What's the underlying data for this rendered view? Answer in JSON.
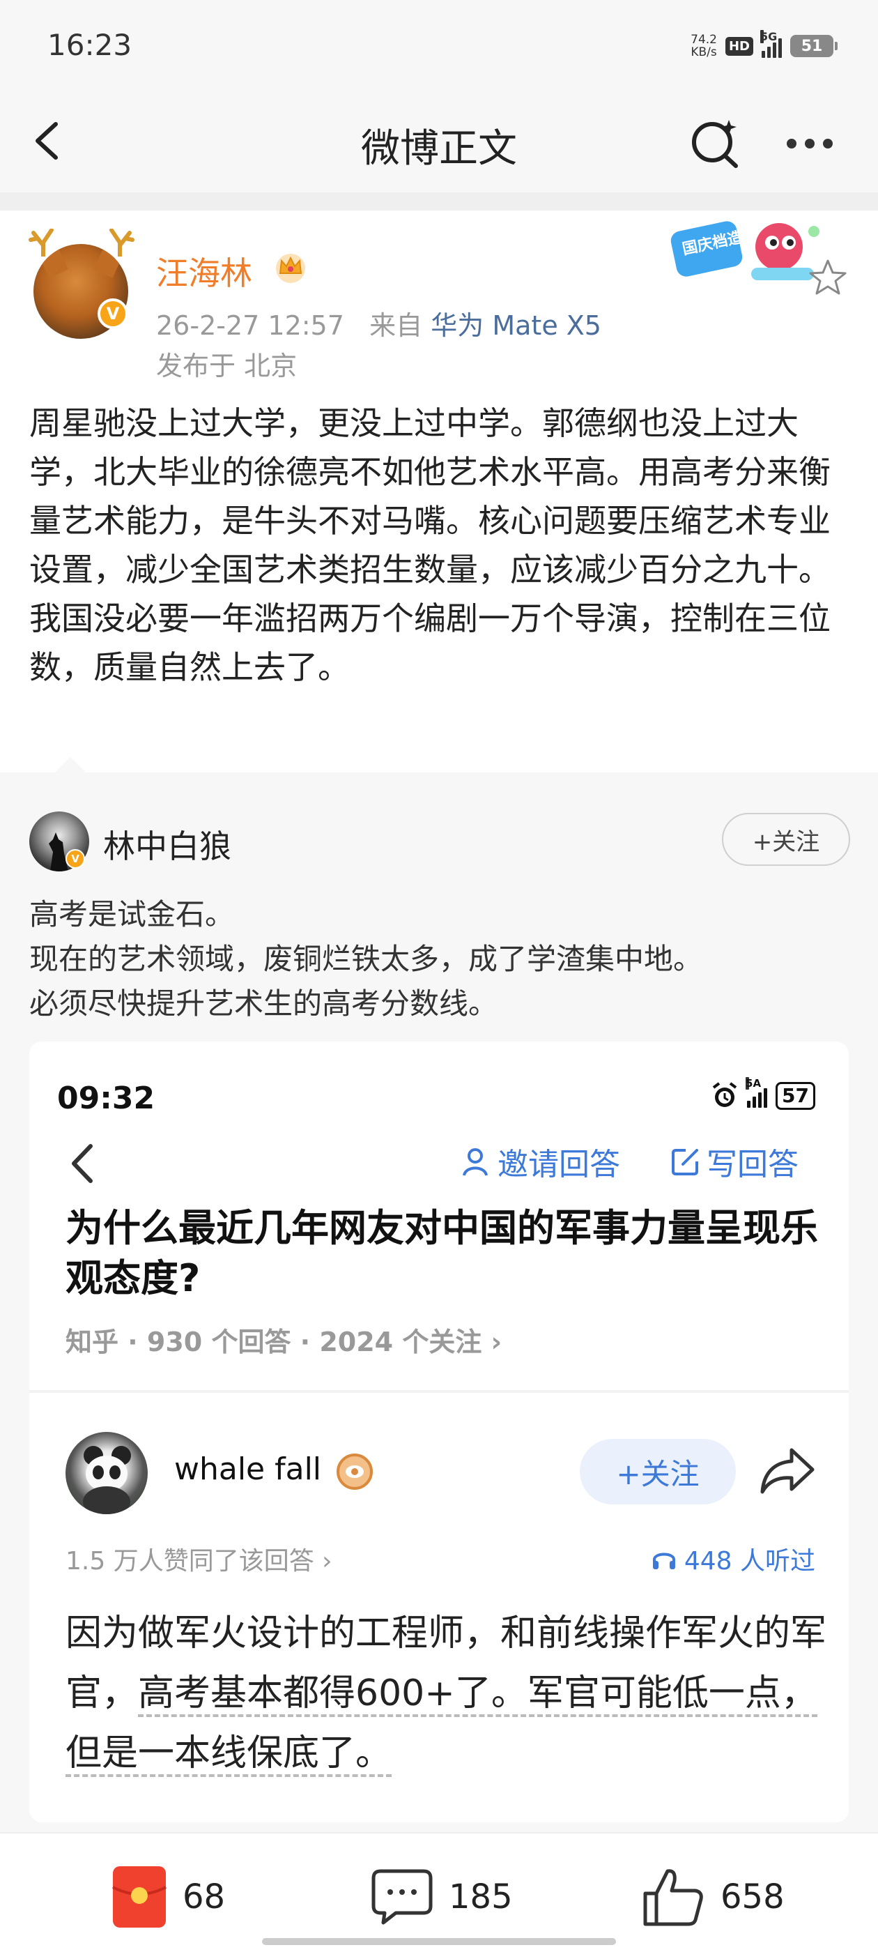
{
  "status_bar": {
    "time": "16:23",
    "net_speed_value": "74.2",
    "net_speed_unit": "KB/s",
    "hd": "HD",
    "network": "5G",
    "battery": "51"
  },
  "nav": {
    "title": "微博正文",
    "back_icon": "chevron-left-icon",
    "search_icon": "search-icon",
    "more_icon": "more-icon"
  },
  "post": {
    "author": "汪海林",
    "timestamp": "26-2-27 12:57",
    "source_prefix": "来自",
    "device": "华为 Mate X5",
    "location": "发布于 北京",
    "badge_text": "国庆档造梗高手",
    "text": "周星驰没上过大学，更没上过中学。郭德纲也没上过大学，北大毕业的徐德亮不如他艺术水平高。用高考分来衡量艺术能力，是牛头不对马嘴。核心问题要压缩艺术专业设置，减少全国艺术类招生数量，应该减少百分之九十。我国没必要一年滥招两万个编剧一万个导演，控制在三位数，质量自然上去了。"
  },
  "retweet": {
    "author": "林中白狼",
    "follow_label": "+关注",
    "lines": [
      "高考是试金石。",
      "现在的艺术领域，废铜烂铁太多，成了学渣集中地。",
      "必须尽快提升艺术生的高考分数线。"
    ]
  },
  "embedded": {
    "time": "09:32",
    "signal": "5A",
    "battery": "57",
    "invite_label": "邀请回答",
    "write_label": "写回答",
    "question": "为什么最近几年网友对中国的军事力量呈现乐观态度?",
    "meta": "知乎 · 930 个回答 · 2024 个关注 ›",
    "answerer": "whale fall",
    "follow_label": "+关注",
    "approve": "1.5 万人赞同了该回答 ›",
    "listen": "448 人听过",
    "answer_part1": "因为做军火设计的工程师，和前线操作军火的军官，",
    "answer_underlined": "高考基本都得600+了。军官可能低一点，但是一本线保底了。"
  },
  "actions": {
    "reward_count": "68",
    "comment_count": "185",
    "like_count": "658"
  },
  "colors": {
    "author_orange": "#f07d2a",
    "link_blue": "#4a6d9c",
    "zhihu_blue": "#3d79d8",
    "reward_red": "#f0402e"
  }
}
